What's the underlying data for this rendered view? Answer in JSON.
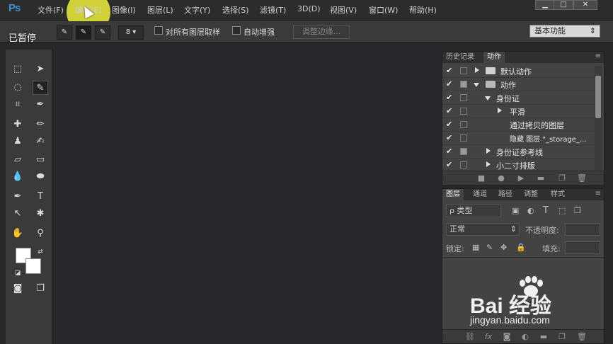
{
  "app": {
    "logo": "Ps"
  },
  "menu": [
    "文件(F)",
    "编辑(E)",
    "图像(I)",
    "图层(L)",
    "文字(Y)",
    "选择(S)",
    "滤镜(T)",
    "3D(D)",
    "视图(V)",
    "窗口(W)",
    "帮助(H)"
  ],
  "window_controls": {
    "minimize": "▁",
    "maximize": "□",
    "close": "✕"
  },
  "overlay": {
    "paused": "已暂停"
  },
  "options": {
    "brush_size": "8",
    "sample_all_layers": "对所有图层取样",
    "auto_enhance": "自动增强",
    "refine_edge": "调整边缘...",
    "workspace": "基本功能"
  },
  "history_panel": {
    "tabs": [
      "历史记录",
      "动作"
    ],
    "actions": [
      {
        "label": "默认动作",
        "checked": "✔",
        "kind": "set-collapsed"
      },
      {
        "label": "动作",
        "checked": "✔",
        "kind": "set-expanded"
      },
      {
        "label": "身份证",
        "checked": "✔",
        "kind": "action-expanded"
      },
      {
        "label": "平滑",
        "checked": "✔",
        "kind": "step-collapsed"
      },
      {
        "label": "通过拷贝的图层",
        "checked": "✔",
        "kind": "step"
      },
      {
        "label": "隐藏 图层 \"_storage_...",
        "checked": "✔",
        "kind": "step"
      },
      {
        "label": "身份证参考线",
        "checked": "✔",
        "kind": "action-collapsed"
      },
      {
        "label": "小二寸排版",
        "checked": "✔",
        "kind": "action-collapsed"
      }
    ]
  },
  "layers_panel": {
    "tabs": [
      "图层",
      "通道",
      "路径",
      "调整",
      "样式"
    ],
    "filter_label": "ρ 类型",
    "blend_mode": "正常",
    "opacity_label": "不透明度:",
    "lock_label": "锁定:",
    "fill_label": "填充:"
  },
  "watermark": {
    "brand": "Bai  经验",
    "url": "jingyan.baidu.com"
  }
}
